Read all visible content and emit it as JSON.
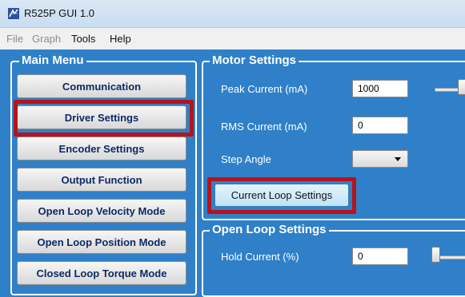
{
  "window": {
    "title": "R525P GUI 1.0"
  },
  "menubar": [
    {
      "label": "File",
      "enabled": false
    },
    {
      "label": "Graph",
      "enabled": false
    },
    {
      "label": "Tools",
      "enabled": true
    },
    {
      "label": "Help",
      "enabled": true
    }
  ],
  "main_menu": {
    "title": "Main Menu",
    "buttons": [
      "Communication",
      "Driver Settings",
      "Encoder Settings",
      "Output Function",
      "Open Loop Velocity Mode",
      "Open Loop Position Mode",
      "Closed Loop Torque Mode"
    ],
    "highlighted": "Driver Settings"
  },
  "motor_settings": {
    "title": "Motor Settings",
    "peak_current_label": "Peak Current (mA)",
    "peak_current_value": "1000",
    "rms_current_label": "RMS Current (mA)",
    "rms_current_value": "0",
    "step_angle_label": "Step Angle",
    "step_angle_value": "",
    "current_loop_button": "Current Loop Settings",
    "highlighted": "Current Loop Settings"
  },
  "open_loop_settings": {
    "title": "Open Loop Settings",
    "hold_current_label": "Hold Current (%)",
    "hold_current_value": "0"
  },
  "colors": {
    "background": "#2f80c8",
    "highlight": "#b8121b",
    "button_text": "#0d2a66"
  },
  "icons": [
    "app-icon",
    "dropdown-arrow-icon"
  ]
}
